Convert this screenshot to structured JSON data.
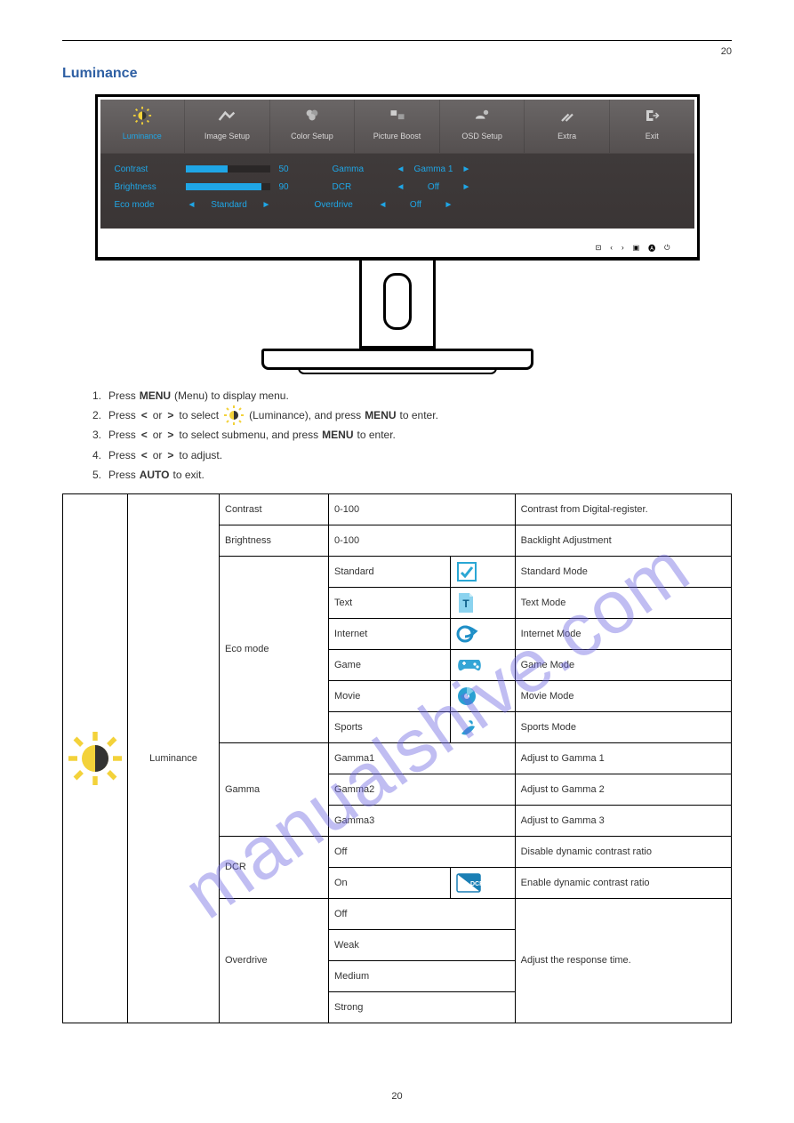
{
  "page": {
    "number_top": "20",
    "number_bottom": "20"
  },
  "section_title": "Luminance",
  "osd": {
    "tabs": [
      {
        "label": "Luminance"
      },
      {
        "label": "Image Setup"
      },
      {
        "label": "Color Setup"
      },
      {
        "label": "Picture Boost"
      },
      {
        "label": "OSD Setup"
      },
      {
        "label": "Extra"
      },
      {
        "label": "Exit"
      }
    ],
    "rows": {
      "contrast": {
        "label": "Contrast",
        "value": "50",
        "fillPercent": 50
      },
      "brightness": {
        "label": "Brightness",
        "value": "90",
        "fillPercent": 90
      },
      "eco": {
        "label": "Eco mode",
        "value": "Standard"
      },
      "gamma": {
        "label": "Gamma",
        "value": "Gamma 1"
      },
      "dcr": {
        "label": "DCR",
        "value": "Off"
      },
      "overdrive": {
        "label": "Overdrive",
        "value": "Off"
      }
    }
  },
  "steps": {
    "s1": {
      "num": "1.",
      "t1": "Press",
      "t2": "(Menu) to display menu."
    },
    "s2": {
      "num": "2.",
      "t1": "Press",
      "t2": "or",
      "t3": "to select",
      "t4": "(Luminance), and press",
      "t5": "to enter."
    },
    "s3": {
      "num": "3.",
      "t1": "Press",
      "t2": "or",
      "t3": "to select submenu, and press",
      "t4": "to enter."
    },
    "s4": {
      "num": "4.",
      "t1": "Press",
      "t2": "or",
      "t3": "to adjust."
    },
    "s5": {
      "num": "5.",
      "t1": "Press",
      "t2": "to exit."
    }
  },
  "table": {
    "category_label": "Luminance",
    "rows": {
      "contrast": {
        "name": "Contrast",
        "value": "0-100",
        "desc": "Contrast from Digital-register."
      },
      "brightness": {
        "name": "Brightness",
        "value": "0-100",
        "desc": "Backlight Adjustment"
      },
      "eco": {
        "name": "Eco mode",
        "items": [
          {
            "mode": "Standard",
            "desc": "Standard Mode"
          },
          {
            "mode": "Text",
            "desc": "Text Mode"
          },
          {
            "mode": "Internet",
            "desc": "Internet Mode"
          },
          {
            "mode": "Game",
            "desc": "Game Mode"
          },
          {
            "mode": "Movie",
            "desc": "Movie Mode"
          },
          {
            "mode": "Sports",
            "desc": "Sports Mode"
          }
        ]
      },
      "gamma": {
        "name": "Gamma",
        "items": [
          {
            "val": "Gamma1",
            "desc": "Adjust to Gamma 1"
          },
          {
            "val": "Gamma2",
            "desc": "Adjust to Gamma 2"
          },
          {
            "val": "Gamma3",
            "desc": "Adjust to Gamma 3"
          }
        ]
      },
      "dcr": {
        "name": "DCR",
        "items": [
          {
            "val": "Off",
            "desc": "Disable dynamic contrast ratio"
          },
          {
            "val": "On",
            "desc": "Enable dynamic contrast ratio"
          }
        ]
      },
      "overdrive": {
        "name": "Overdrive",
        "desc": "Adjust the response time.",
        "items": [
          {
            "val": "Off"
          },
          {
            "val": "Weak"
          },
          {
            "val": "Medium"
          },
          {
            "val": "Strong"
          }
        ]
      }
    }
  },
  "watermark": "manualshive.com"
}
